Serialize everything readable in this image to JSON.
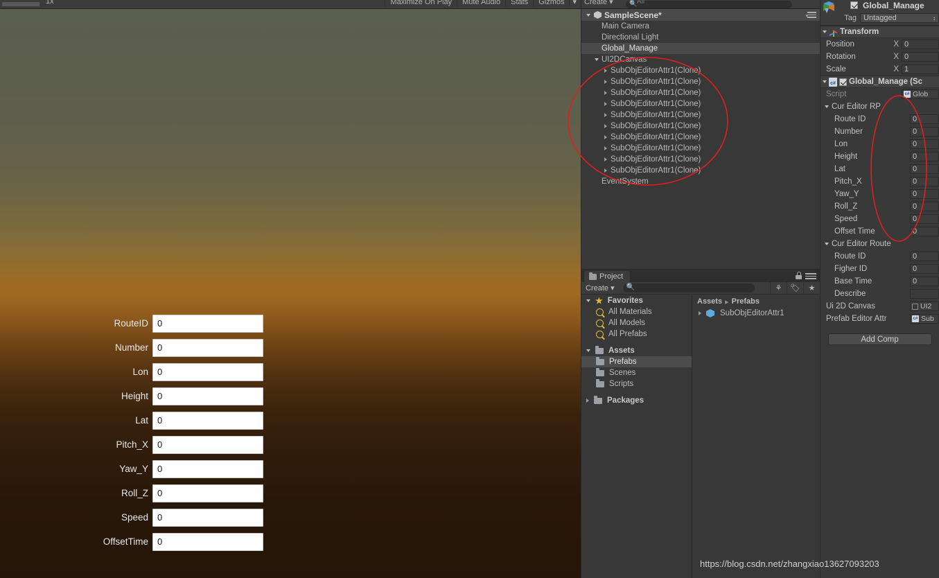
{
  "game_view": {
    "toolbar": {
      "scale_label": "1x",
      "buttons": [
        "Maximize On Play",
        "Mute Audio",
        "Stats",
        "Gizmos"
      ],
      "gizmos_arrow": "▾"
    },
    "form_fields": [
      {
        "label": "RouteID",
        "value": "0"
      },
      {
        "label": "Number",
        "value": "0"
      },
      {
        "label": "Lon",
        "value": "0"
      },
      {
        "label": "Height",
        "value": "0"
      },
      {
        "label": "Lat",
        "value": "0"
      },
      {
        "label": "Pitch_X",
        "value": "0"
      },
      {
        "label": "Yaw_Y",
        "value": "0"
      },
      {
        "label": "Roll_Z",
        "value": "0"
      },
      {
        "label": "Speed",
        "value": "0"
      },
      {
        "label": "OffsetTime",
        "value": "0"
      }
    ]
  },
  "hierarchy": {
    "toolbar": {
      "create_label": "Create",
      "create_arrow": "▾",
      "search_placeholder": "All"
    },
    "scene_name": "SampleScene*",
    "items": [
      {
        "label": "Main Camera",
        "depth": 1,
        "expandable": false,
        "selected": false
      },
      {
        "label": "Directional Light",
        "depth": 1,
        "expandable": false,
        "selected": false
      },
      {
        "label": "Global_Manage",
        "depth": 1,
        "expandable": false,
        "selected": true
      },
      {
        "label": "UI2DCanvas",
        "depth": 1,
        "expandable": true,
        "expanded": true,
        "selected": false
      },
      {
        "label": "SubObjEditorAttr1(Clone)",
        "depth": 2,
        "expandable": true,
        "selected": false
      },
      {
        "label": "SubObjEditorAttr1(Clone)",
        "depth": 2,
        "expandable": true,
        "selected": false
      },
      {
        "label": "SubObjEditorAttr1(Clone)",
        "depth": 2,
        "expandable": true,
        "selected": false
      },
      {
        "label": "SubObjEditorAttr1(Clone)",
        "depth": 2,
        "expandable": true,
        "selected": false
      },
      {
        "label": "SubObjEditorAttr1(Clone)",
        "depth": 2,
        "expandable": true,
        "selected": false
      },
      {
        "label": "SubObjEditorAttr1(Clone)",
        "depth": 2,
        "expandable": true,
        "selected": false
      },
      {
        "label": "SubObjEditorAttr1(Clone)",
        "depth": 2,
        "expandable": true,
        "selected": false
      },
      {
        "label": "SubObjEditorAttr1(Clone)",
        "depth": 2,
        "expandable": true,
        "selected": false
      },
      {
        "label": "SubObjEditorAttr1(Clone)",
        "depth": 2,
        "expandable": true,
        "selected": false
      },
      {
        "label": "SubObjEditorAttr1(Clone)",
        "depth": 2,
        "expandable": true,
        "selected": false
      },
      {
        "label": "EventSystem",
        "depth": 1,
        "expandable": false,
        "selected": false
      }
    ]
  },
  "project": {
    "tab_label": "Project",
    "toolbar": {
      "create_label": "Create",
      "create_arrow": "▾"
    },
    "breadcrumb": [
      "Assets",
      "Prefabs"
    ],
    "breadcrumb_sep": "▸",
    "tree": [
      {
        "label": "Favorites",
        "kind": "star",
        "depth": 0,
        "expanded": true,
        "bold": true
      },
      {
        "label": "All Materials",
        "kind": "search",
        "depth": 1,
        "bold": false
      },
      {
        "label": "All Models",
        "kind": "search",
        "depth": 1,
        "bold": false
      },
      {
        "label": "All Prefabs",
        "kind": "search",
        "depth": 1,
        "bold": false
      },
      {
        "label": "Assets",
        "kind": "folder",
        "depth": 0,
        "expanded": true,
        "bold": true
      },
      {
        "label": "Prefabs",
        "kind": "folder",
        "depth": 1,
        "selected": true,
        "bold": false
      },
      {
        "label": "Scenes",
        "kind": "folder",
        "depth": 1,
        "bold": false
      },
      {
        "label": "Scripts",
        "kind": "folder",
        "depth": 1,
        "bold": false
      },
      {
        "label": "Packages",
        "kind": "folder",
        "depth": 0,
        "expanded": false,
        "bold": true
      }
    ],
    "contents": [
      {
        "label": "SubObjEditorAttr1",
        "kind": "prefab",
        "expandable": true
      }
    ]
  },
  "inspector": {
    "object_name": "Global_Manage",
    "object_enabled": true,
    "tag_label": "Tag",
    "tag_value": "Untagged",
    "components": [
      {
        "title": "Transform",
        "icon": "transform-axis-icon",
        "rows": [
          {
            "label": "Position",
            "axis": "X",
            "value": "0"
          },
          {
            "label": "Rotation",
            "axis": "X",
            "value": "0"
          },
          {
            "label": "Scale",
            "axis": "X",
            "value": "1"
          }
        ]
      },
      {
        "title": "Global_Manage (Sc",
        "icon": "csharp-script-icon",
        "enabled": true,
        "script_label": "Script",
        "script_value": "Glob",
        "groups": [
          {
            "group_label": "Cur Editor RP",
            "expanded": true,
            "fields": [
              {
                "label": "Route ID",
                "value": "0"
              },
              {
                "label": "Number",
                "value": "0"
              },
              {
                "label": "Lon",
                "value": "0"
              },
              {
                "label": "Height",
                "value": "0"
              },
              {
                "label": "Lat",
                "value": "0"
              },
              {
                "label": "Pitch_X",
                "value": "0"
              },
              {
                "label": "Yaw_Y",
                "value": "0"
              },
              {
                "label": "Roll_Z",
                "value": "0"
              },
              {
                "label": "Speed",
                "value": "0"
              },
              {
                "label": "Offset Time",
                "value": "0"
              }
            ]
          },
          {
            "group_label": "Cur Editor Route",
            "expanded": true,
            "fields": [
              {
                "label": "Route ID",
                "value": "0"
              },
              {
                "label": "Figher ID",
                "value": "0"
              },
              {
                "label": "Base Time",
                "value": "0"
              },
              {
                "label": "Describe",
                "value": ""
              }
            ]
          }
        ],
        "object_fields": [
          {
            "label": "Ui 2D Canvas",
            "value": "UI2",
            "icon": "checkbox-icon"
          },
          {
            "label": "Prefab Editor Attr",
            "value": "Sub",
            "icon": "csharp-script-icon"
          }
        ]
      }
    ],
    "add_component_label": "Add Comp"
  },
  "watermark": "https://blog.csdn.net/zhangxiao13627093203",
  "annotations": {
    "color": "#e02020",
    "stroke": 1.6
  }
}
